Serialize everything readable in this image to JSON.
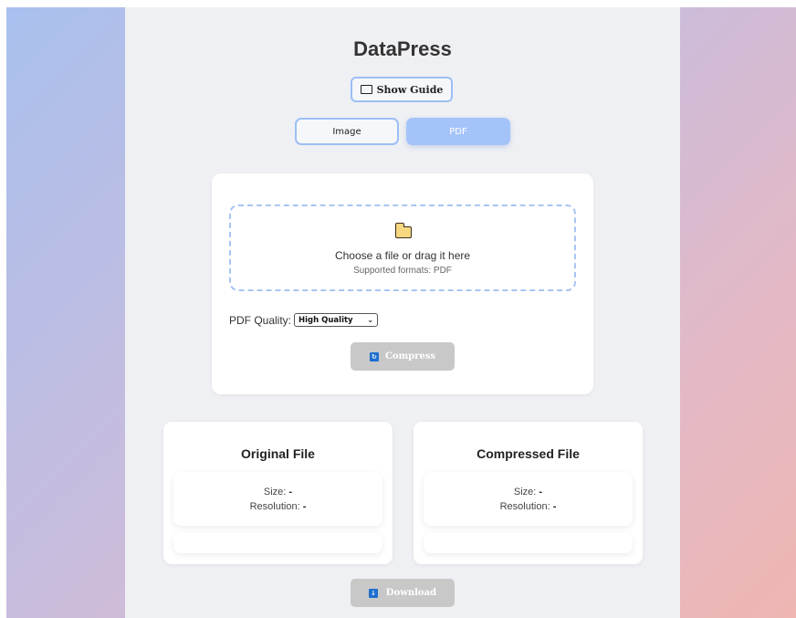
{
  "app": {
    "title": "DataPress",
    "guide_button": {
      "label": "Show Guide",
      "icon": "book-icon"
    }
  },
  "mode_tabs": {
    "items": [
      {
        "label": "Image",
        "active": false
      },
      {
        "label": "PDF",
        "active": true
      }
    ]
  },
  "upload": {
    "icon": "folder-icon",
    "main_text": "Choose a file or drag it here",
    "formats_text": "Supported formats: PDF",
    "quality_label": "PDF Quality:",
    "quality_selected": "High Quality",
    "compress_label": "Compress",
    "compress_icon": "refresh-icon"
  },
  "original": {
    "title": "Original File",
    "size_label": "Size:",
    "size_value": "-",
    "resolution_label": "Resolution:",
    "resolution_value": "-"
  },
  "compressed": {
    "title": "Compressed File",
    "size_label": "Size:",
    "size_value": "-",
    "resolution_label": "Resolution:",
    "resolution_value": "-"
  },
  "download": {
    "label": "Download",
    "icon": "download-icon"
  },
  "colors": {
    "accent": "#9cbff5",
    "active_tab": "#a4c4f9",
    "disabled_button": "#c8c8c8",
    "panel": "#eff0f3"
  }
}
